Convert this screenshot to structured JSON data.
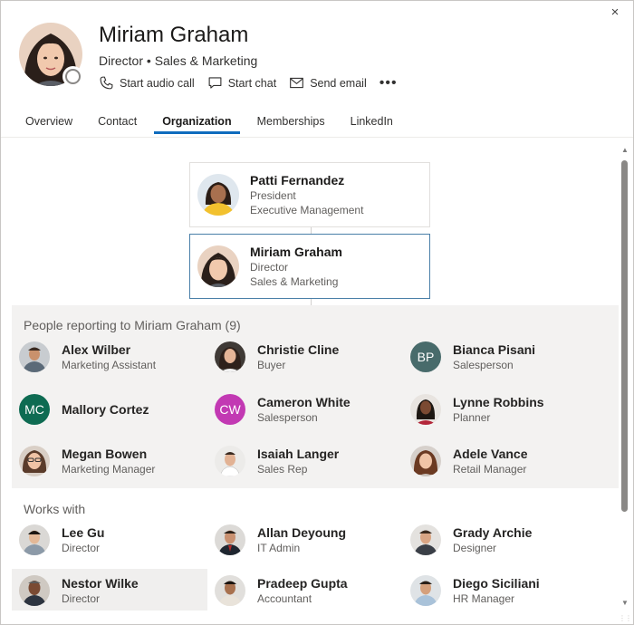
{
  "profile": {
    "name": "Miriam Graham",
    "title": "Director • Sales & Marketing"
  },
  "actions": {
    "audio_call": "Start audio call",
    "chat": "Start chat",
    "email": "Send email",
    "more": "•••"
  },
  "close_label": "×",
  "tabs": [
    {
      "label": "Overview"
    },
    {
      "label": "Contact"
    },
    {
      "label": "Organization"
    },
    {
      "label": "Memberships"
    },
    {
      "label": "LinkedIn"
    }
  ],
  "org_chain": [
    {
      "name": "Patti Fernandez",
      "role": "President",
      "dept": "Executive Management"
    },
    {
      "name": "Miriam Graham",
      "role": "Director",
      "dept": "Sales & Marketing"
    }
  ],
  "reports": {
    "title": "People reporting to Miriam Graham (9)",
    "people": [
      {
        "name": "Alex Wilber",
        "role": "Marketing Assistant",
        "initials": "",
        "color": ""
      },
      {
        "name": "Christie Cline",
        "role": "Buyer",
        "initials": "",
        "color": ""
      },
      {
        "name": "Bianca Pisani",
        "role": "Salesperson",
        "initials": "BP",
        "color": "#486b6b"
      },
      {
        "name": "Mallory Cortez",
        "role": "",
        "initials": "MC",
        "color": "#0e6b52"
      },
      {
        "name": "Cameron White",
        "role": "Salesperson",
        "initials": "CW",
        "color": "#c239b3"
      },
      {
        "name": "Lynne Robbins",
        "role": "Planner",
        "initials": "",
        "color": ""
      },
      {
        "name": "Megan Bowen",
        "role": "Marketing Manager",
        "initials": "",
        "color": ""
      },
      {
        "name": "Isaiah Langer",
        "role": "Sales Rep",
        "initials": "",
        "color": ""
      },
      {
        "name": "Adele Vance",
        "role": "Retail Manager",
        "initials": "",
        "color": ""
      }
    ]
  },
  "works_with": {
    "title": "Works with",
    "people": [
      {
        "name": "Lee Gu",
        "role": "Director"
      },
      {
        "name": "Allan Deyoung",
        "role": "IT Admin"
      },
      {
        "name": "Grady Archie",
        "role": "Designer"
      },
      {
        "name": "Nestor Wilke",
        "role": "Director"
      },
      {
        "name": "Pradeep Gupta",
        "role": "Accountant"
      },
      {
        "name": "Diego Siciliani",
        "role": "HR Manager"
      }
    ]
  }
}
